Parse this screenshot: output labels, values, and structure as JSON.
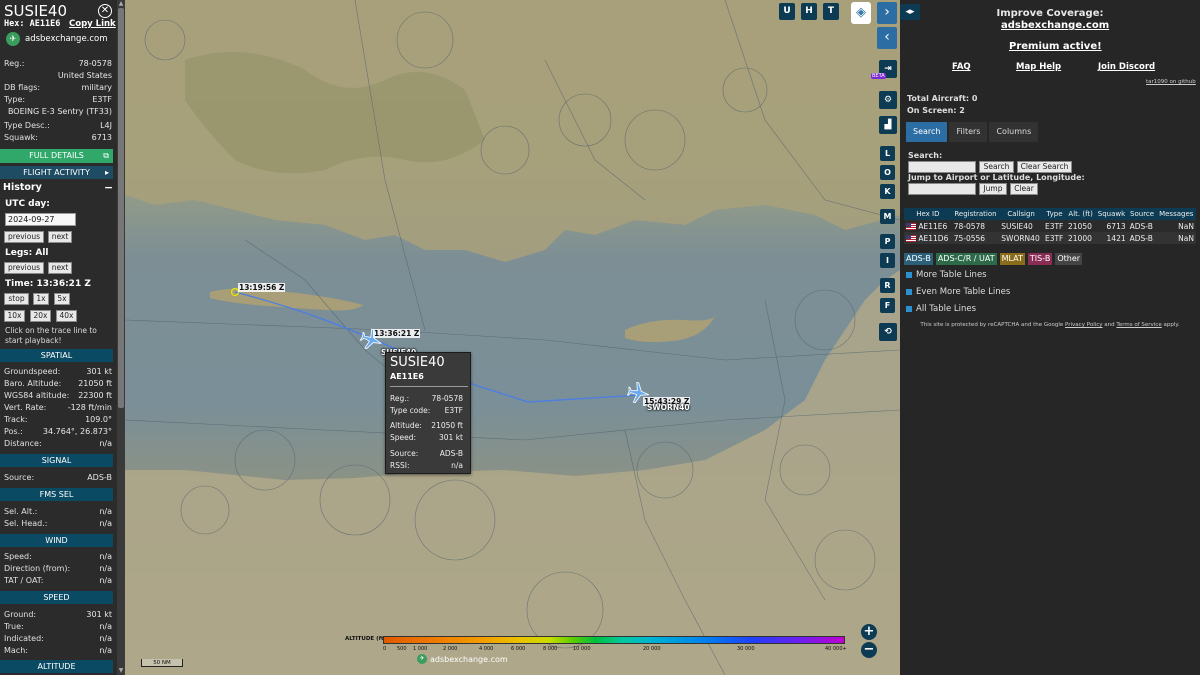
{
  "left": {
    "callsign": "SUSIE40",
    "hex_label": "Hex:",
    "hex": "AE11E6",
    "copy_link": "Copy Link",
    "source_site": "adsbexchange.com",
    "details": [
      {
        "k": "Reg.:",
        "v": "78-0578"
      },
      {
        "k": "",
        "v": "United States"
      },
      {
        "k": "DB flags:",
        "v": "military"
      },
      {
        "k": "Type:",
        "v": "E3TF"
      },
      {
        "k": "",
        "v": "BOEING E-3 Sentry (TF33)"
      },
      {
        "k": "Type Desc.:",
        "v": "L4J"
      },
      {
        "k": "Squawk:",
        "v": "6713"
      }
    ],
    "full_details": "FULL DETAILS",
    "flight_activity": "FLIGHT ACTIVITY",
    "history": "History",
    "utc_day_label": "UTC day:",
    "utc_day": "2024-09-27",
    "previous": "previous",
    "next": "next",
    "legs_label": "Legs: All",
    "time_label": "Time: 13:36:21 Z",
    "speeds": [
      "stop",
      "1x",
      "5x",
      "10x",
      "20x",
      "40x"
    ],
    "help": "Click on the trace line to start playback!",
    "spatial_title": "SPATIAL",
    "spatial": [
      {
        "k": "Groundspeed:",
        "v": "301 kt"
      },
      {
        "k": "Baro. Altitude:",
        "v": "21050 ft"
      },
      {
        "k": "WGS84 altitude:",
        "v": "22300 ft"
      },
      {
        "k": "Vert. Rate:",
        "v": "-128 ft/min"
      },
      {
        "k": "Track:",
        "v": "109.0°"
      },
      {
        "k": "Pos.:",
        "v": "34.764°, 26.873°"
      },
      {
        "k": "Distance:",
        "v": "n/a"
      }
    ],
    "signal_title": "SIGNAL",
    "signal": [
      {
        "k": "Source:",
        "v": "ADS-B"
      }
    ],
    "fms_title": "FMS SEL",
    "fms": [
      {
        "k": "Sel. Alt.:",
        "v": "n/a"
      },
      {
        "k": "Sel. Head.:",
        "v": "n/a"
      }
    ],
    "wind_title": "WIND",
    "wind": [
      {
        "k": "Speed:",
        "v": "n/a"
      },
      {
        "k": "Direction (from):",
        "v": "n/a"
      },
      {
        "k": "TAT / OAT:",
        "v": "n/a"
      }
    ],
    "speed_title": "SPEED",
    "speed": [
      {
        "k": "Ground:",
        "v": "301 kt"
      },
      {
        "k": "True:",
        "v": "n/a"
      },
      {
        "k": "Indicated:",
        "v": "n/a"
      },
      {
        "k": "Mach:",
        "v": "n/a"
      }
    ],
    "altitude_title": "ALTITUDE"
  },
  "map": {
    "top_buttons": [
      "U",
      "H",
      "T"
    ],
    "side_buttons": [
      "L",
      "O",
      "K",
      "M",
      "P",
      "I",
      "R",
      "F"
    ],
    "beta": "BETA",
    "trace_labels": [
      "13:19:56 Z",
      "13:36:21 Z",
      "15:43:29 Z"
    ],
    "plane_labels": [
      "SUSIE40",
      "SWORN40"
    ],
    "popup": {
      "callsign": "SUSIE40",
      "hex": "AE11E6",
      "rows_a": [
        {
          "k": "Reg.:",
          "v": "78-0578"
        },
        {
          "k": "Type code:",
          "v": "E3TF"
        }
      ],
      "rows_b": [
        {
          "k": "Altitude:",
          "v": "21050 ft"
        },
        {
          "k": "Speed:",
          "v": "301 kt"
        }
      ],
      "rows_c": [
        {
          "k": "Source:",
          "v": "ADS-B"
        },
        {
          "k": "RSSI:",
          "v": "n/a"
        }
      ]
    },
    "altitude_title": "ALTITUDE (ft)",
    "altitude_ticks": [
      "0",
      "500",
      "1 000",
      "2 000",
      "4 000",
      "6 000",
      "8 000",
      "10 000",
      "20 000",
      "30 000",
      "40 000+"
    ],
    "scale": "50 NM",
    "logo": "adsbexchange.com",
    "zoom_in": "+",
    "zoom_out": "−"
  },
  "right": {
    "improve": "Improve Coverage:",
    "improve_link": "adsbexchange.com",
    "premium": "Premium active!",
    "links": [
      "FAQ",
      "Map Help",
      "Join Discord"
    ],
    "github": "tar1090 on github",
    "total": "Total Aircraft: 0",
    "on_screen": "On Screen: 2",
    "tabs": [
      "Search",
      "Filters",
      "Columns"
    ],
    "search_label": "Search:",
    "search_btn": "Search",
    "clear_search_btn": "Clear Search",
    "jump_label": "Jump to Airport or Latitude, Longitude:",
    "jump_btn": "Jump",
    "clear_btn": "Clear",
    "columns": [
      "Hex ID",
      "Registration",
      "Callsign",
      "Type",
      "Alt. (ft)",
      "Squawk",
      "Source",
      "Messages"
    ],
    "rows": [
      [
        "AE11E6",
        "78-0578",
        "SUSIE40",
        "E3TF",
        "21050",
        "6713",
        "ADS-B",
        "NaN"
      ],
      [
        "AE11D6",
        "75-0556",
        "SWORN40",
        "E3TF",
        "21000",
        "1421",
        "ADS-B",
        "NaN"
      ]
    ],
    "sources": [
      {
        "label": "ADS-B",
        "color": "#2c5f7a"
      },
      {
        "label": "ADS-C/R / UAT",
        "color": "#2d6a4a"
      },
      {
        "label": "MLAT",
        "color": "#8a6d1a"
      },
      {
        "label": "TIS-B",
        "color": "#8a2d55"
      },
      {
        "label": "Other",
        "color": "#444444"
      }
    ],
    "table_lines": [
      "More Table Lines",
      "Even More Table Lines",
      "All Table Lines"
    ],
    "footer_pre": "This site is protected by reCAPTCHA and the Google",
    "footer_privacy": "Privacy Policy",
    "footer_and": "and",
    "footer_terms": "Terms of Service",
    "footer_post": "apply."
  },
  "colors": {
    "accent": "#2c6da4",
    "full_details": "#2fa86a",
    "section": "#0b4a63",
    "trace": "#4a7de8"
  }
}
